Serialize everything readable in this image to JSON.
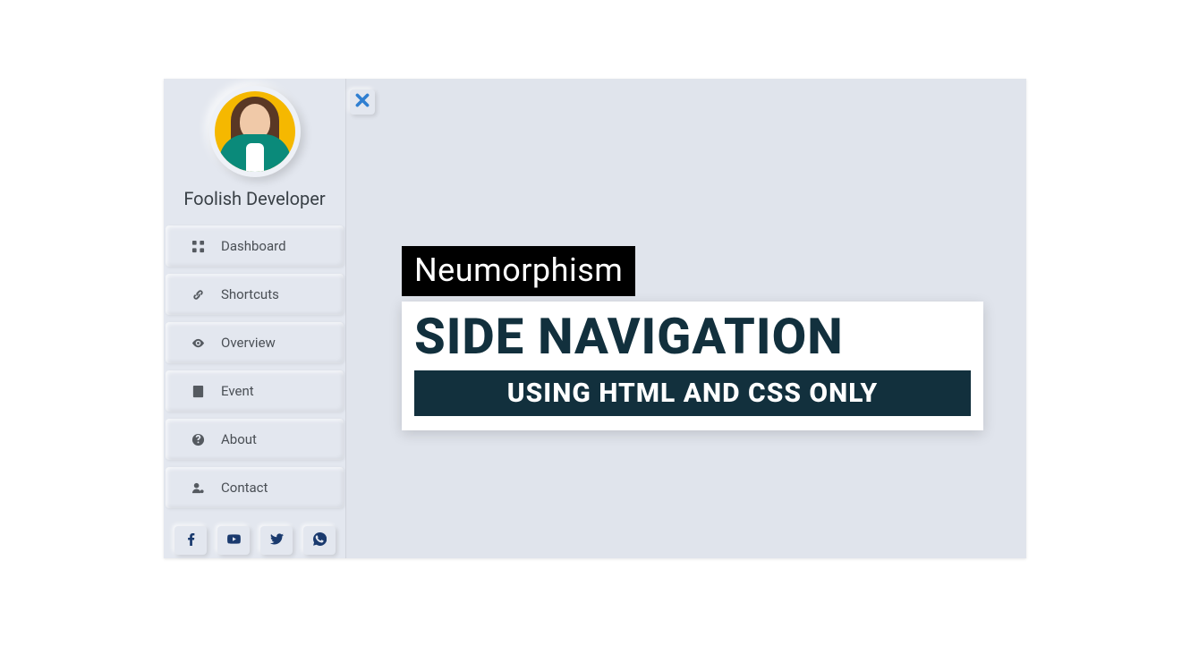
{
  "profile": {
    "name": "Foolish Developer"
  },
  "nav": {
    "items": [
      {
        "label": "Dashboard",
        "icon": "grid-icon"
      },
      {
        "label": "Shortcuts",
        "icon": "link-icon"
      },
      {
        "label": "Overview",
        "icon": "eye-icon"
      },
      {
        "label": "Event",
        "icon": "book-icon"
      },
      {
        "label": "About",
        "icon": "question-icon"
      },
      {
        "label": "Contact",
        "icon": "user-icon"
      }
    ]
  },
  "social": {
    "items": [
      {
        "name": "facebook"
      },
      {
        "name": "youtube"
      },
      {
        "name": "twitter"
      },
      {
        "name": "whatsapp"
      }
    ]
  },
  "banner": {
    "tag": "Neumorphism",
    "title": "SIDE NAVIGATION",
    "subtitle": "USING HTML AND CSS ONLY"
  },
  "colors": {
    "bg": "#e0e4ec",
    "sidebar": "#e3e7ef",
    "accent": "#2f7fd1",
    "bannerDark": "#12303d"
  }
}
